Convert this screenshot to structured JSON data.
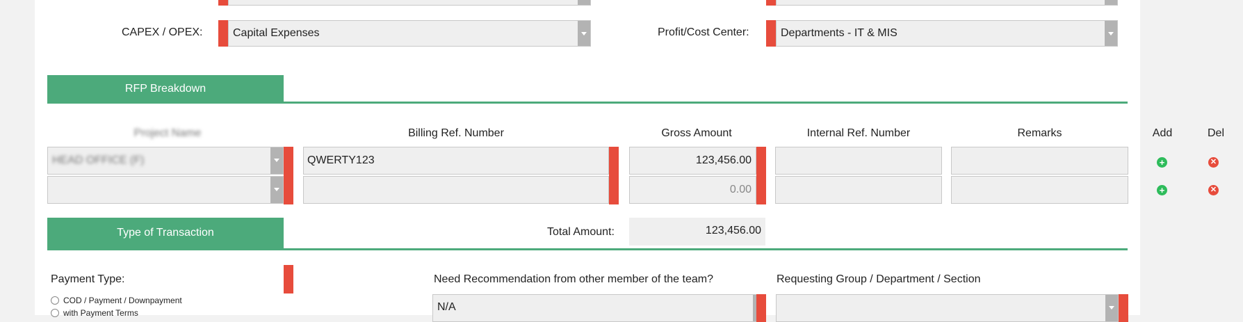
{
  "fields": {
    "capex_label": "CAPEX / OPEX:",
    "capex_value": "Capital Expenses",
    "profit_label": "Profit/Cost Center:",
    "profit_value": "Departments - IT & MIS"
  },
  "rfp": {
    "title": "RFP Breakdown",
    "headers": {
      "project": "Project Name",
      "billing": "Billing Ref. Number",
      "gross": "Gross Amount",
      "internal": "Internal Ref. Number",
      "remarks": "Remarks",
      "add": "Add",
      "del": "Del"
    },
    "rows": [
      {
        "project": "HEAD OFFICE (F)",
        "billing": "QWERTY123",
        "gross": "123,456.00",
        "internal": "",
        "remarks": ""
      },
      {
        "project": "",
        "billing": "",
        "gross": "0.00",
        "internal": "",
        "remarks": ""
      }
    ]
  },
  "transaction": {
    "title": "Type of Transaction",
    "total_label": "Total Amount:",
    "total_value": "123,456.00",
    "payment_type_label": "Payment Type:",
    "payment_options": [
      "COD / Payment / Downpayment",
      "with Payment Terms"
    ],
    "recommendation_label": "Need Recommendation from other member of the team?",
    "recommendation_value": "N/A",
    "requesting_label": "Requesting Group / Department / Section",
    "requesting_value": ""
  },
  "colors": {
    "accent_green": "#4caa7b",
    "required_red": "#e74c3c",
    "add_green": "#2ebc5b"
  }
}
